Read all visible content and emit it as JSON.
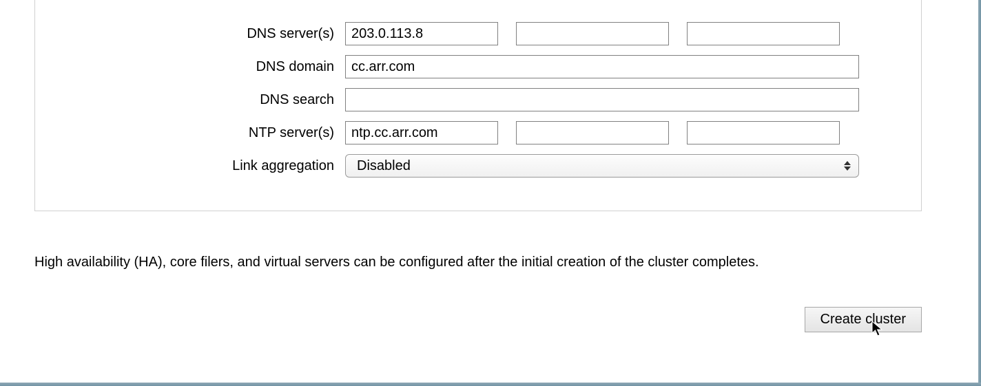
{
  "form": {
    "dns_servers": {
      "label": "DNS server(s)",
      "values": [
        "203.0.113.8",
        "",
        ""
      ]
    },
    "dns_domain": {
      "label": "DNS domain",
      "value": "cc.arr.com"
    },
    "dns_search": {
      "label": "DNS search",
      "value": ""
    },
    "ntp_servers": {
      "label": "NTP server(s)",
      "values": [
        "ntp.cc.arr.com",
        "",
        ""
      ]
    },
    "link_aggregation": {
      "label": "Link aggregation",
      "selected": "Disabled"
    }
  },
  "hint": "High availability (HA), core filers, and virtual servers can be configured after the initial creation of the cluster completes.",
  "actions": {
    "create_cluster": "Create cluster"
  }
}
